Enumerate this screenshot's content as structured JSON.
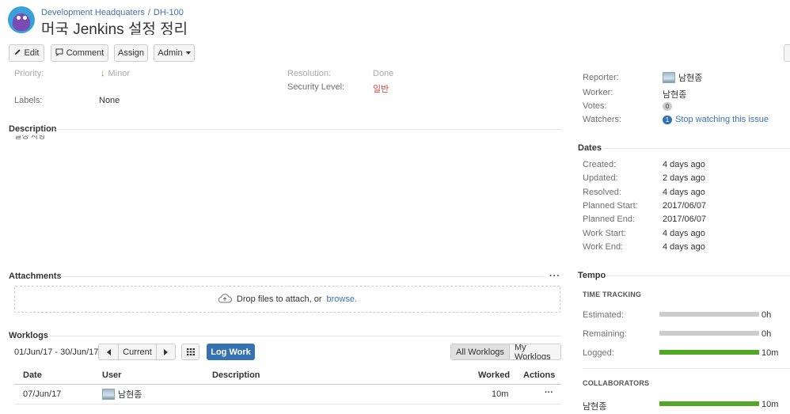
{
  "header": {
    "project": "Development Headquaters",
    "issue_key": "DH-100",
    "title": "머국 Jenkins 설정 정리"
  },
  "toolbar": {
    "edit": "Edit",
    "comment": "Comment",
    "assign": "Assign",
    "admin": "Admin"
  },
  "details": {
    "priority_label": "Priority:",
    "priority_value": "Minor",
    "labels_label": "Labels:",
    "labels_value": "None",
    "resolution_label": "Resolution:",
    "resolution_value": "Done",
    "security_label": "Security Level:",
    "security_value": "일반",
    "security_color": "#d04437"
  },
  "description": {
    "heading": "Description",
    "text": "설정 사항"
  },
  "attachments": {
    "heading": "Attachments",
    "drop_text": "Drop files to attach, or",
    "browse": "browse."
  },
  "worklogs": {
    "heading": "Worklogs",
    "range": "01/Jun/17 - 30/Jun/17",
    "current": "Current",
    "log_work": "Log Work",
    "all_worklogs": "All Worklogs",
    "my_worklogs": "My Worklogs",
    "columns": {
      "date": "Date",
      "user": "User",
      "description": "Description",
      "worked": "Worked",
      "actions": "Actions"
    },
    "rows": [
      {
        "date": "07/Jun/17",
        "user": "남현종",
        "description": "",
        "worked": "10m",
        "actions": "···"
      }
    ]
  },
  "people": {
    "reporter_label": "Reporter:",
    "reporter_value": "남현종",
    "worker_label": "Worker:",
    "worker_value": "남현종",
    "votes_label": "Votes:",
    "votes_count": "0",
    "watchers_label": "Watchers:",
    "watchers_count": "1",
    "watch_link": "Stop watching this issue"
  },
  "dates": {
    "heading": "Dates",
    "items": [
      {
        "label": "Created:",
        "value": "4 days ago"
      },
      {
        "label": "Updated:",
        "value": "2 days ago"
      },
      {
        "label": "Resolved:",
        "value": "4 days ago"
      },
      {
        "label": "Planned Start:",
        "value": "2017/06/07"
      },
      {
        "label": "Planned End:",
        "value": "2017/06/07"
      },
      {
        "label": "Work Start:",
        "value": "4 days ago"
      },
      {
        "label": "Work End:",
        "value": "4 days ago"
      }
    ]
  },
  "tempo": {
    "heading": "Tempo",
    "time_tracking": "TIME TRACKING",
    "estimated_label": "Estimated:",
    "estimated_value": "0h",
    "estimated_fill": 0,
    "remaining_label": "Remaining:",
    "remaining_value": "0h",
    "remaining_fill": 0,
    "logged_label": "Logged:",
    "logged_value": "10m",
    "logged_fill": 1,
    "collaborators": "COLLABORATORS",
    "collab_name": "남현종",
    "collab_value": "10m",
    "collab_fill": 1,
    "grey_color": "#cccccc",
    "green_color": "#51a825"
  },
  "icons": {
    "priority": "arrow-down-icon",
    "upload": "cloud-upload-icon",
    "calendar": "grid-calendar-icon"
  }
}
